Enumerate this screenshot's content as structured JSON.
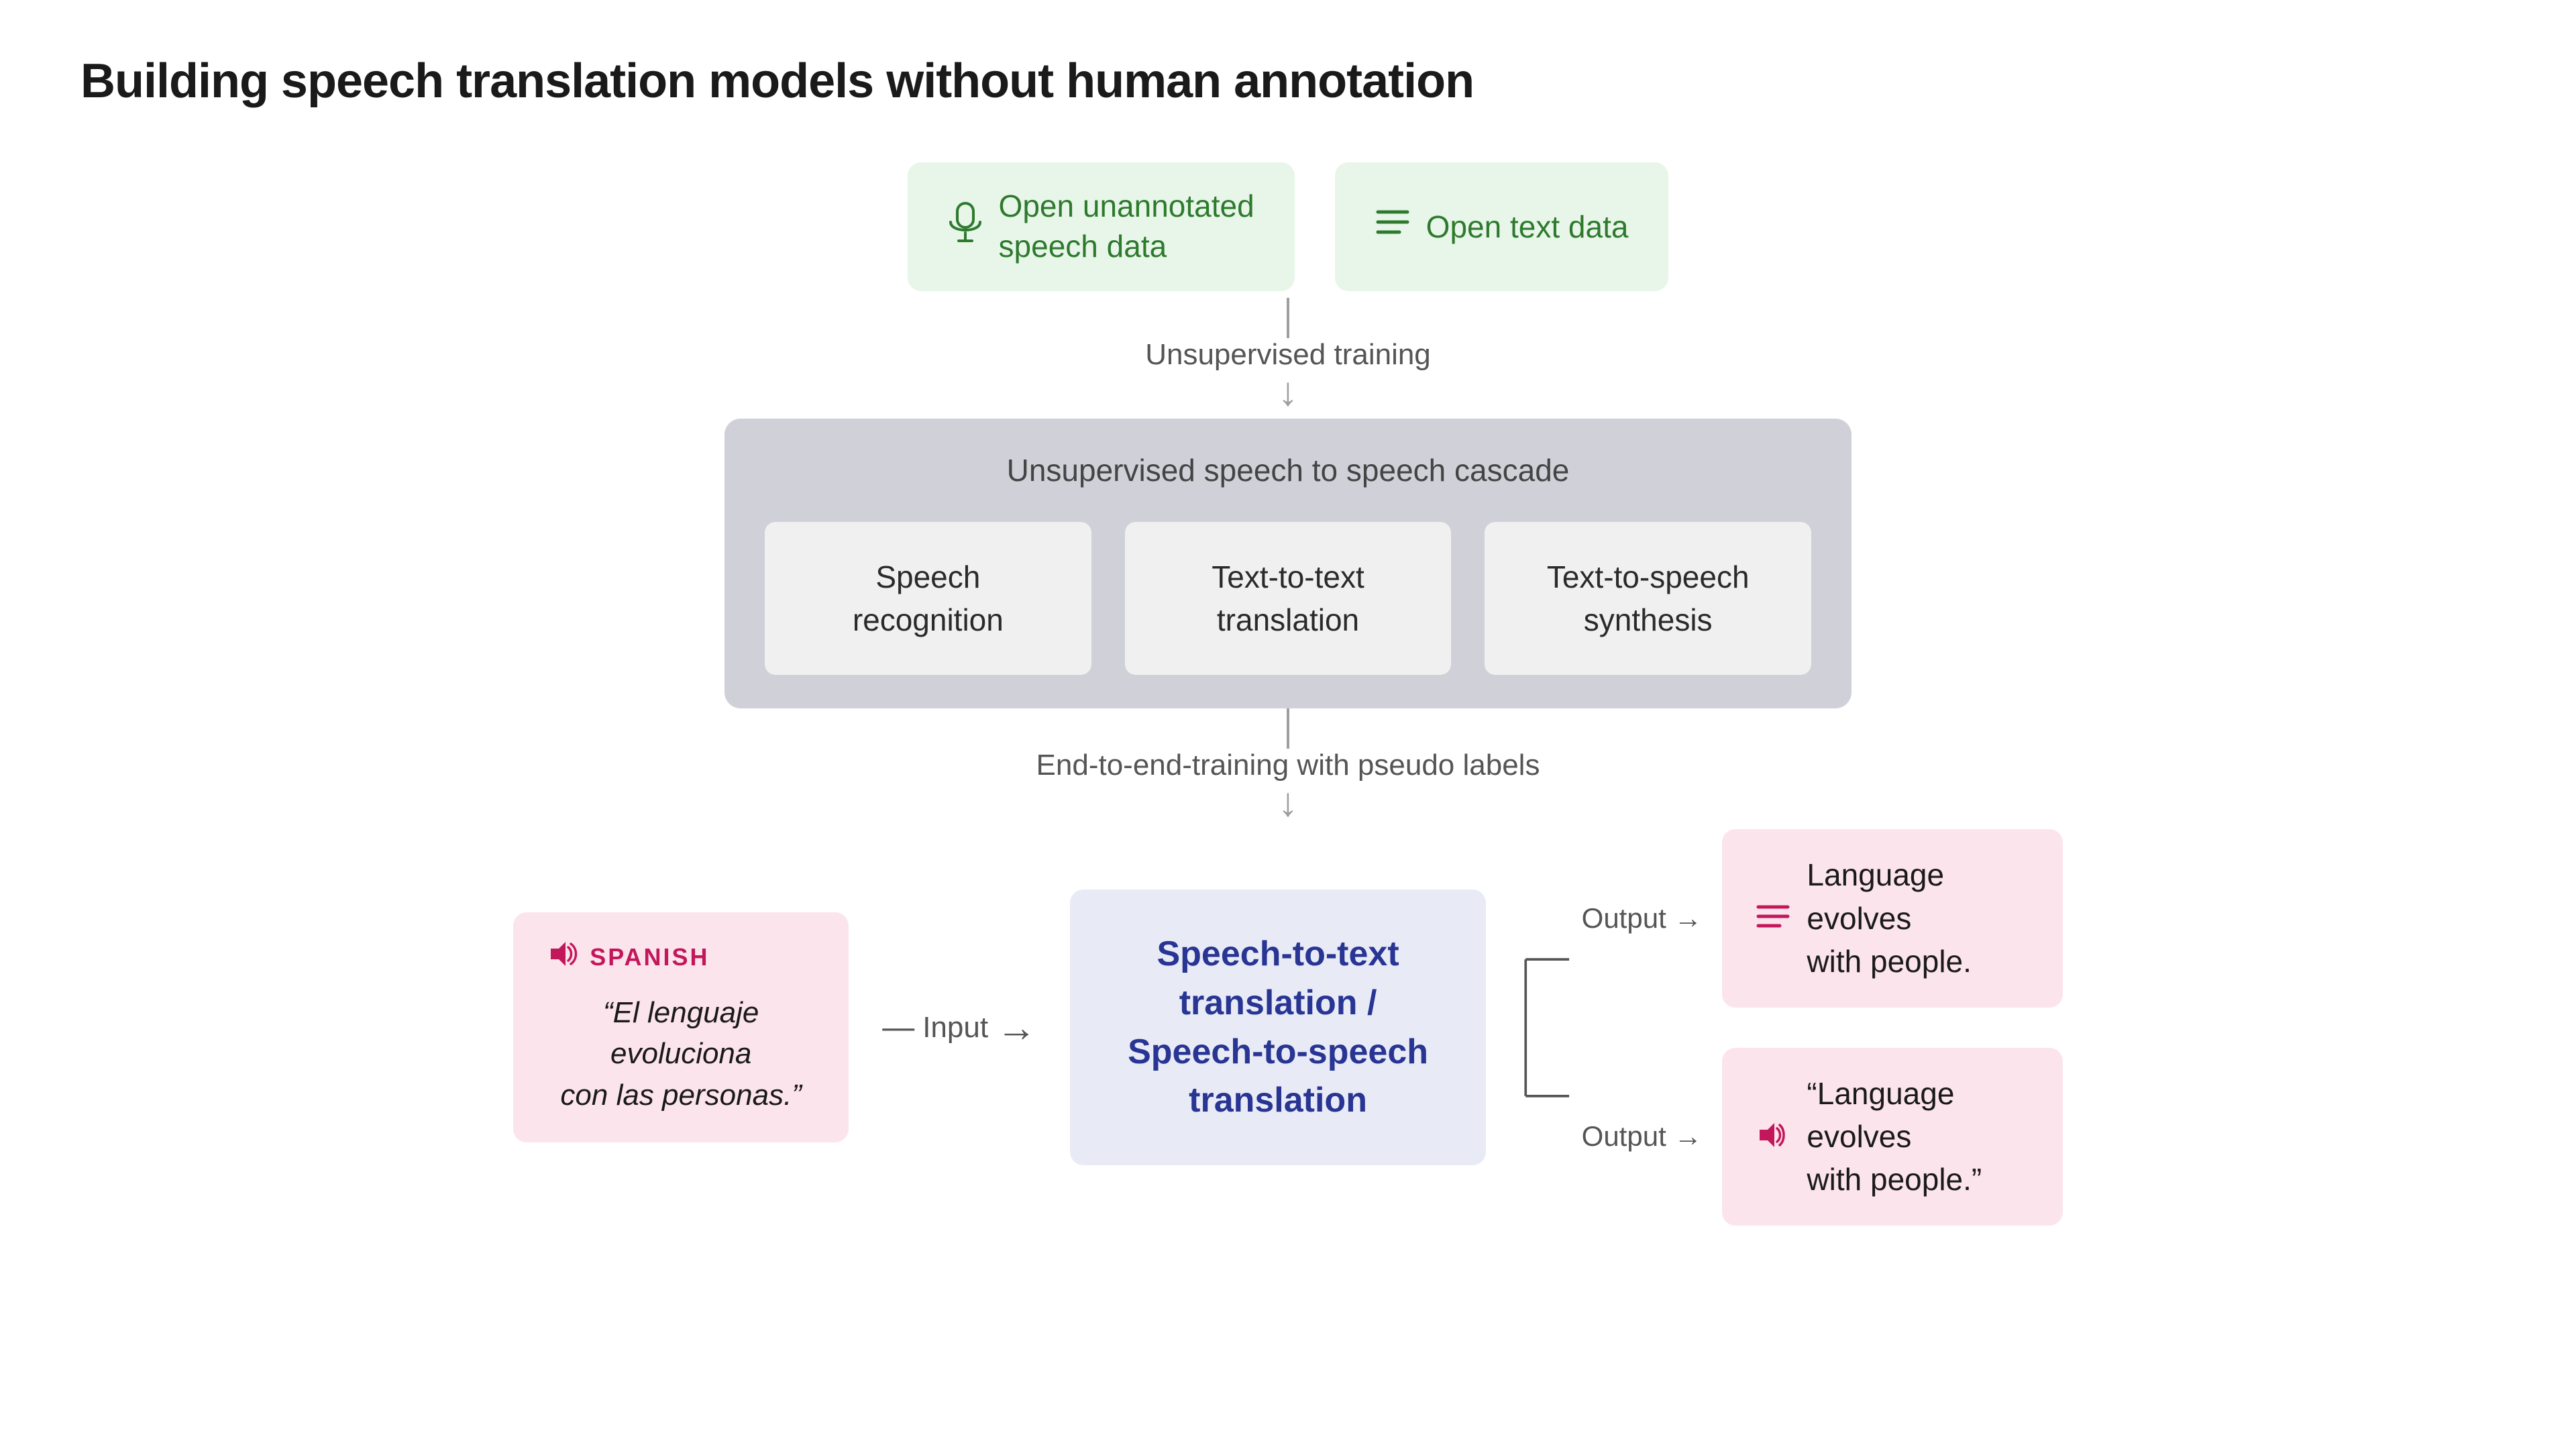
{
  "page": {
    "title": "Building speech translation models without human annotation"
  },
  "top_inputs": {
    "speech": {
      "label": "Open unannotated\nspeech data",
      "icon": "microphone"
    },
    "text": {
      "label": "Open text data",
      "icon": "text-lines"
    }
  },
  "flow": {
    "unsupervised_training_label": "Unsupervised training",
    "cascade_title": "Unsupervised speech to speech cascade",
    "cascade_items": [
      {
        "label": "Speech\nrecognition"
      },
      {
        "label": "Text-to-text\ntranslation"
      },
      {
        "label": "Text-to-speech\nsynthesis"
      }
    ],
    "end_to_end_label": "End-to-end-training with pseudo labels",
    "translation_box_text": "Speech-to-text translation /\nSpeech-to-speech translation",
    "input_label": "Input",
    "output_label": "Output"
  },
  "input_example": {
    "language": "SPANISH",
    "quote": "“El lenguaje evoluciona\ncon las personas.”"
  },
  "outputs": [
    {
      "type": "text",
      "content": "Language evolves\nwith people."
    },
    {
      "type": "speech",
      "content": "“Language evolves\nwith people.”"
    }
  ],
  "colors": {
    "green_bg": "#e8f5e9",
    "green_text": "#2d7a2d",
    "grey_cascade": "#d0d0d8",
    "grey_item": "#f0f0f0",
    "blue_translation": "#e8eaf6",
    "blue_text": "#283593",
    "pink_bg": "#fce4ec",
    "pink_text": "#c2185b",
    "connector": "#9e9e9e",
    "label_text": "#555555"
  }
}
